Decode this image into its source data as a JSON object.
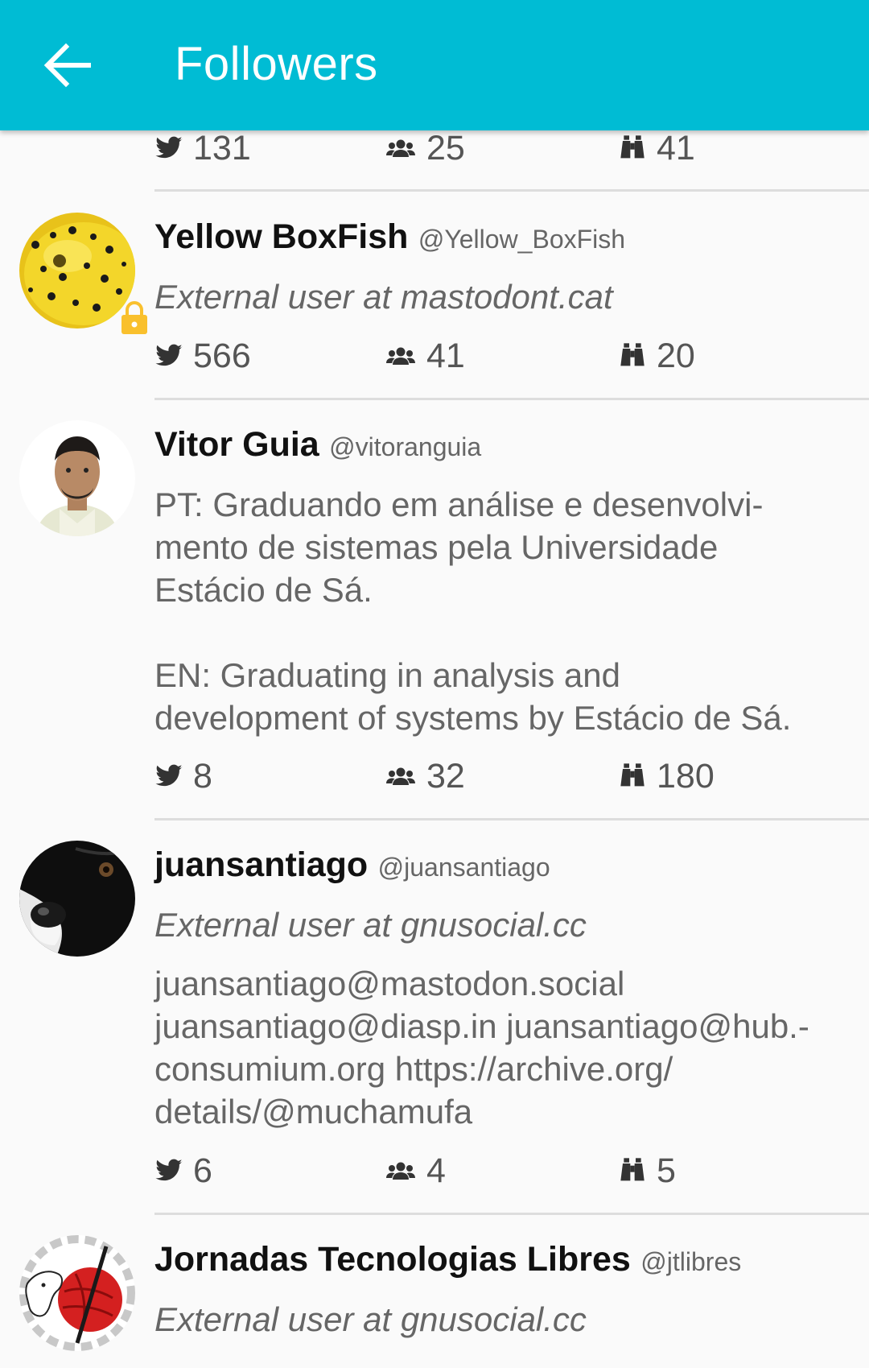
{
  "appbar": {
    "title": "Followers",
    "back_icon": "arrow-left-icon"
  },
  "colors": {
    "appbar": "#00bcd4",
    "lock": "#f9c02d"
  },
  "partial_item": {
    "statuses": "131",
    "following": "25",
    "followers": "41"
  },
  "items": [
    {
      "name": "Yellow BoxFish",
      "handle": "@Yellow_BoxFish",
      "bio": "External user at mastodont.cat",
      "locked": true,
      "statuses": "566",
      "following": "41",
      "followers": "20"
    },
    {
      "name": "Vitor Guia",
      "handle": "@vitoranguia",
      "bio_lines": [
        "PT: Graduando em análise e desenvolvi-",
        "mento de sistemas pela Universidade",
        "Estácio de Sá.",
        "EN: Graduating in analysis and",
        "development of systems by Estácio de Sá."
      ],
      "statuses": "8",
      "following": "32",
      "followers": "180"
    },
    {
      "name": "juansantiago",
      "handle": "@juansantiago",
      "bio": "External user at gnusocial.cc",
      "bio2_lines": [
        "juansantiago@mastodon.social",
        "juansantiago@diasp.in juansantiago@hub.-",
        "consumium.org https://archive.org/",
        "details/@muchamufa"
      ],
      "statuses": "6",
      "following": "4",
      "followers": "5"
    },
    {
      "name": "Jornadas Tecnologias Libres",
      "handle": "@jtlibres",
      "bio": "External user at gnusocial.cc"
    }
  ]
}
